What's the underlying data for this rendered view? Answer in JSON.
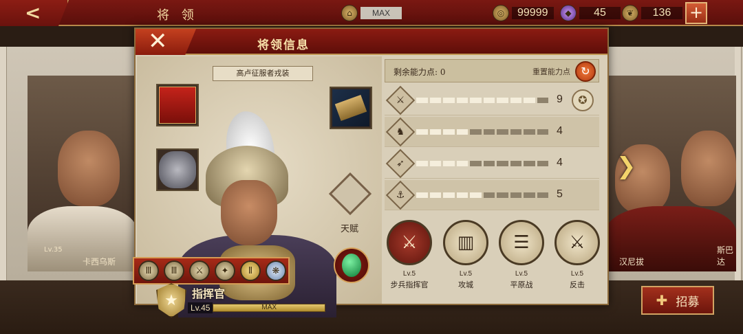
{
  "topbar": {
    "back_icon": "back-arrow-icon",
    "title": "将 领",
    "building_max": "MAX",
    "coins": "99999",
    "gems": "45",
    "food": "136",
    "plus": "+"
  },
  "heroes_bg": {
    "left_name": "卡西乌斯",
    "left_lv": "Lv.35",
    "right_name": "汉尼拔",
    "far_right_name": "斯巴达"
  },
  "recruit": {
    "label": "招募"
  },
  "modal": {
    "title": "将领信息",
    "close": "✕",
    "skin_label": "高卢征服者戎装",
    "talent_label": "天赋",
    "badges": [
      "Ⅲ",
      "Ⅲ",
      "⚔",
      "✦",
      "Ⅱ",
      "❋"
    ],
    "rank_name": "指挥官",
    "level": "Lv.45",
    "level_bar": "MAX"
  },
  "stats": {
    "remaining_label": "剩余能力点:  0",
    "reset_label": "重置能力点",
    "rows": [
      {
        "icon": "sword-icon",
        "glyph": "⚔",
        "value": "9",
        "filled": 9,
        "total": 10,
        "laurel": true
      },
      {
        "icon": "horse-icon",
        "glyph": "♞",
        "value": "4",
        "filled": 4,
        "total": 10
      },
      {
        "icon": "bow-icon",
        "glyph": "➶",
        "value": "4",
        "filled": 4,
        "total": 10
      },
      {
        "icon": "anchor-icon",
        "glyph": "⚓",
        "value": "5",
        "filled": 5,
        "total": 10
      }
    ]
  },
  "skills": [
    {
      "level": "Lv.5",
      "name": "步兵指挥官",
      "glyph": "⚔",
      "red": true
    },
    {
      "level": "Lv.5",
      "name": "攻城",
      "glyph": "▥"
    },
    {
      "level": "Lv.5",
      "name": "平原战",
      "glyph": "☰"
    },
    {
      "level": "Lv.5",
      "name": "反击",
      "glyph": "⚔"
    }
  ],
  "colors": {
    "accent_red": "#8b1b12",
    "gold": "#d59b54",
    "parchment": "#d9cfb9"
  }
}
